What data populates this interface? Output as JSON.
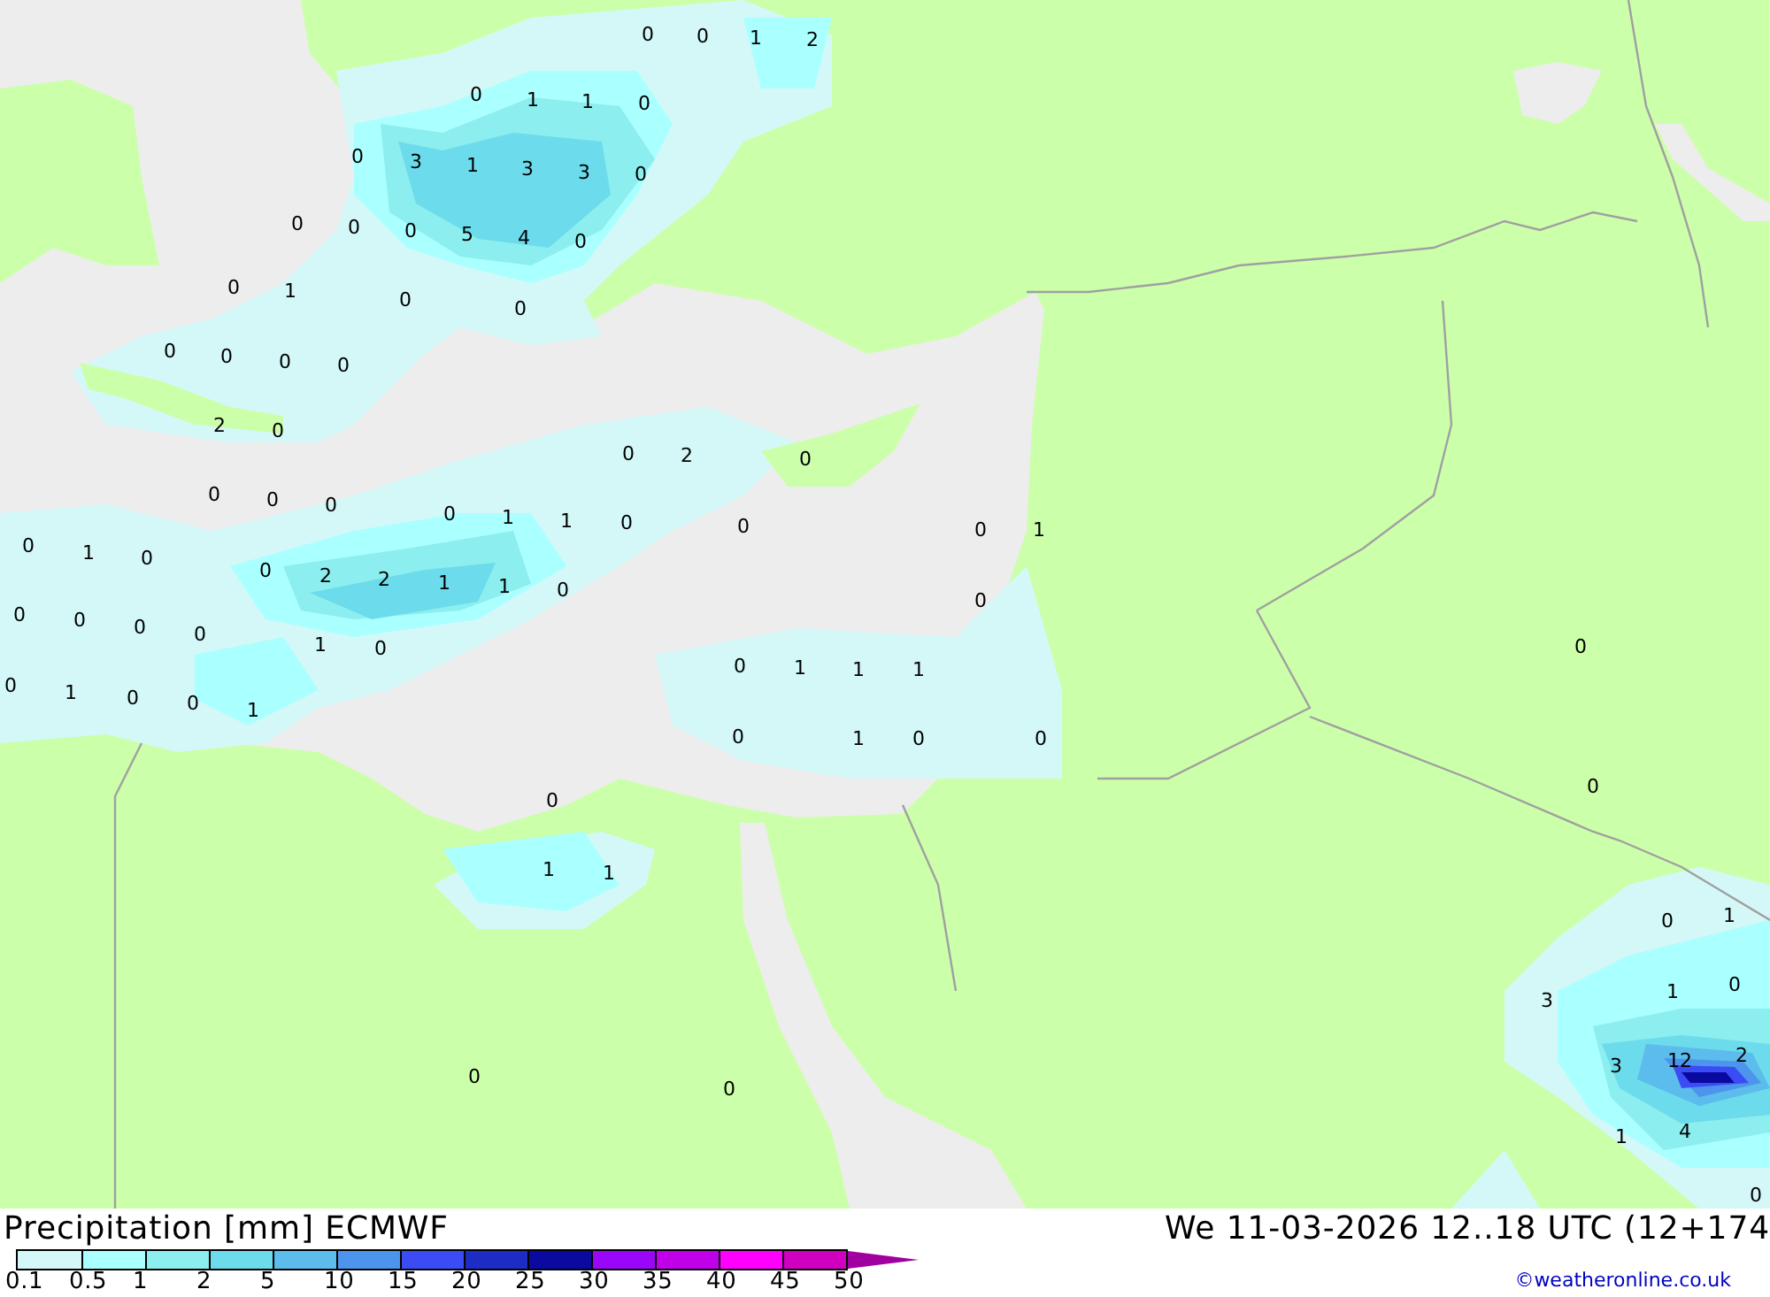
{
  "map": {
    "labels": [
      "0",
      "0",
      "1",
      "2",
      "0",
      "1",
      "1",
      "0",
      "0",
      "3",
      "1",
      "3",
      "3",
      "0",
      "0",
      "0",
      "0",
      "5",
      "4",
      "0",
      "0",
      "1",
      "0",
      "0",
      "0",
      "0",
      "0",
      "0",
      "2",
      "0",
      "0",
      "2",
      "0",
      "0",
      "0",
      "0",
      "0",
      "1",
      "1",
      "0",
      "0",
      "0",
      "1",
      "0",
      "1",
      "0",
      "0",
      "2",
      "2",
      "1",
      "1",
      "0",
      "0",
      "0",
      "0",
      "0",
      "0",
      "1",
      "0",
      "0",
      "0",
      "1",
      "1",
      "1",
      "0",
      "1",
      "0",
      "0",
      "1",
      "0",
      "1",
      "0",
      "0",
      "0",
      "0",
      "1",
      "1",
      "0",
      "1",
      "3",
      "1",
      "0",
      "3",
      "12",
      "2",
      "0",
      "0",
      "1",
      "4",
      "0"
    ]
  },
  "footer": {
    "title": "Precipitation [mm] ECMWF",
    "valid": "We 11-03-2026 12..18 UTC (12+174",
    "credit": "©weatheronline.co.uk",
    "legend": {
      "bins": [
        {
          "color": "#d4f8f8"
        },
        {
          "color": "#aaffff"
        },
        {
          "color": "#8ceeee"
        },
        {
          "color": "#6cdcec"
        },
        {
          "color": "#5cbcec"
        },
        {
          "color": "#4c94ec"
        },
        {
          "color": "#3c4cf4"
        },
        {
          "color": "#1c2cc4"
        },
        {
          "color": "#0a0aa0"
        },
        {
          "color": "#9a06f8"
        },
        {
          "color": "#c000e8"
        },
        {
          "color": "#ff00ff"
        },
        {
          "color": "#d000c0"
        }
      ],
      "ticks": [
        "0.1",
        "0.5",
        "1",
        "2",
        "5",
        "10",
        "15",
        "20",
        "25",
        "30",
        "35",
        "40",
        "45",
        "50"
      ]
    }
  }
}
